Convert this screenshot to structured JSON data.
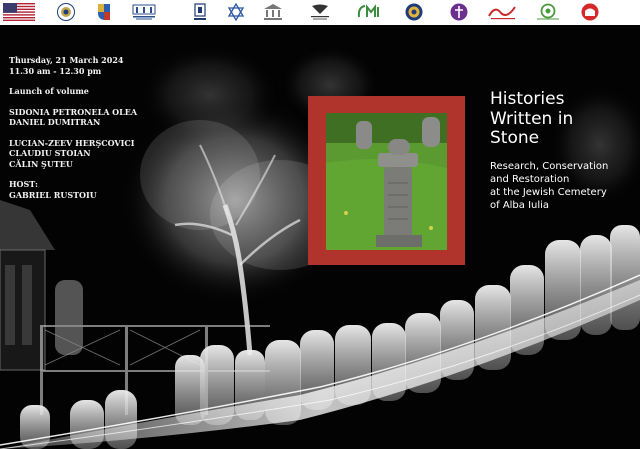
{
  "event": {
    "date": "Thursday, 21 March 2024",
    "time": "11.30 am - 12.30 pm",
    "type": "Launch of volume",
    "authors_group_1": [
      "SIDONIA PETRONELA OLEA",
      "DANIEL DUMITRAN"
    ],
    "authors_group_2": [
      "LUCIAN-ZEEV HERŞCOVICI",
      "CLAUDIU STOIAN",
      "CĂLIN ŞUTEU"
    ],
    "host_label": "HOST:",
    "host_name": "GABRIEL RUSTOIU"
  },
  "title": {
    "lines": [
      "Histories",
      "Written in",
      "Stone"
    ]
  },
  "subtitle": {
    "lines": [
      "Research, Conservation",
      "and Restoration",
      "at the Jewish Cemetery",
      "of Alba Iulia"
    ]
  },
  "logos": [
    "us-flag-icon",
    "us-embassy-seal-icon",
    "alba-county-crest-icon",
    "national-museum-union-logo",
    "university-crest-icon",
    "star-of-david-icon",
    "library-building-logo",
    "conservation-restoration-logo",
    "jmi-logo",
    "round-seal-logo",
    "violet-emblem-logo",
    "red-script-logo",
    "green-circle-logo",
    "red-dome-logo"
  ],
  "colors": {
    "background": "#030303",
    "frame": "#b0342c",
    "text": "#ffffff"
  }
}
